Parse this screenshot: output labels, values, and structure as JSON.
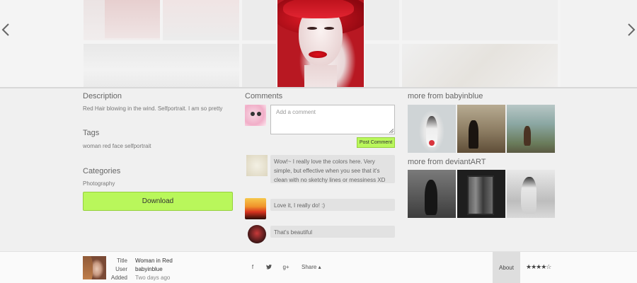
{
  "description": {
    "heading": "Description",
    "text": "Red Hair blowing in the wind. Selfportrait. I am so pretty"
  },
  "tags": {
    "heading": "Tags",
    "text": "woman red face selfportrait"
  },
  "categories": {
    "heading": "Categories",
    "text": "Photography"
  },
  "download_label": "Download",
  "comments": {
    "heading": "Comments",
    "input_placeholder": "Add a comment",
    "post_label": "Post Comment",
    "items": [
      {
        "text": "Wow!~ I really love the colors here. Very simple, but effective when you see that it's clean with no sketchy lines or messiness XD"
      },
      {
        "text": "Love it, I really do! :)"
      },
      {
        "text": "That's beautiful"
      }
    ]
  },
  "more_from_user": {
    "heading": "more from babyinblue"
  },
  "more_from_site": {
    "heading": "more from deviantART"
  },
  "bottom_bar": {
    "title_label": "Title",
    "title_value": "Woman in Red",
    "user_label": "User",
    "user_value": "babyinblue",
    "added_label": "Added",
    "added_value": "Two days ago",
    "share_icons": [
      "facebook-icon",
      "twitter-icon",
      "google-plus-icon"
    ],
    "facebook_glyph": "f",
    "google_plus_glyph": "g+",
    "share_label": "Share ▴",
    "about_label": "About",
    "rating_stars": "★★★★☆",
    "rating_value": 4,
    "rating_max": 5
  },
  "colors": {
    "accent_green": "#b9f75b",
    "background": "#f0f0f0",
    "bottom_bar": "#fafafa"
  }
}
